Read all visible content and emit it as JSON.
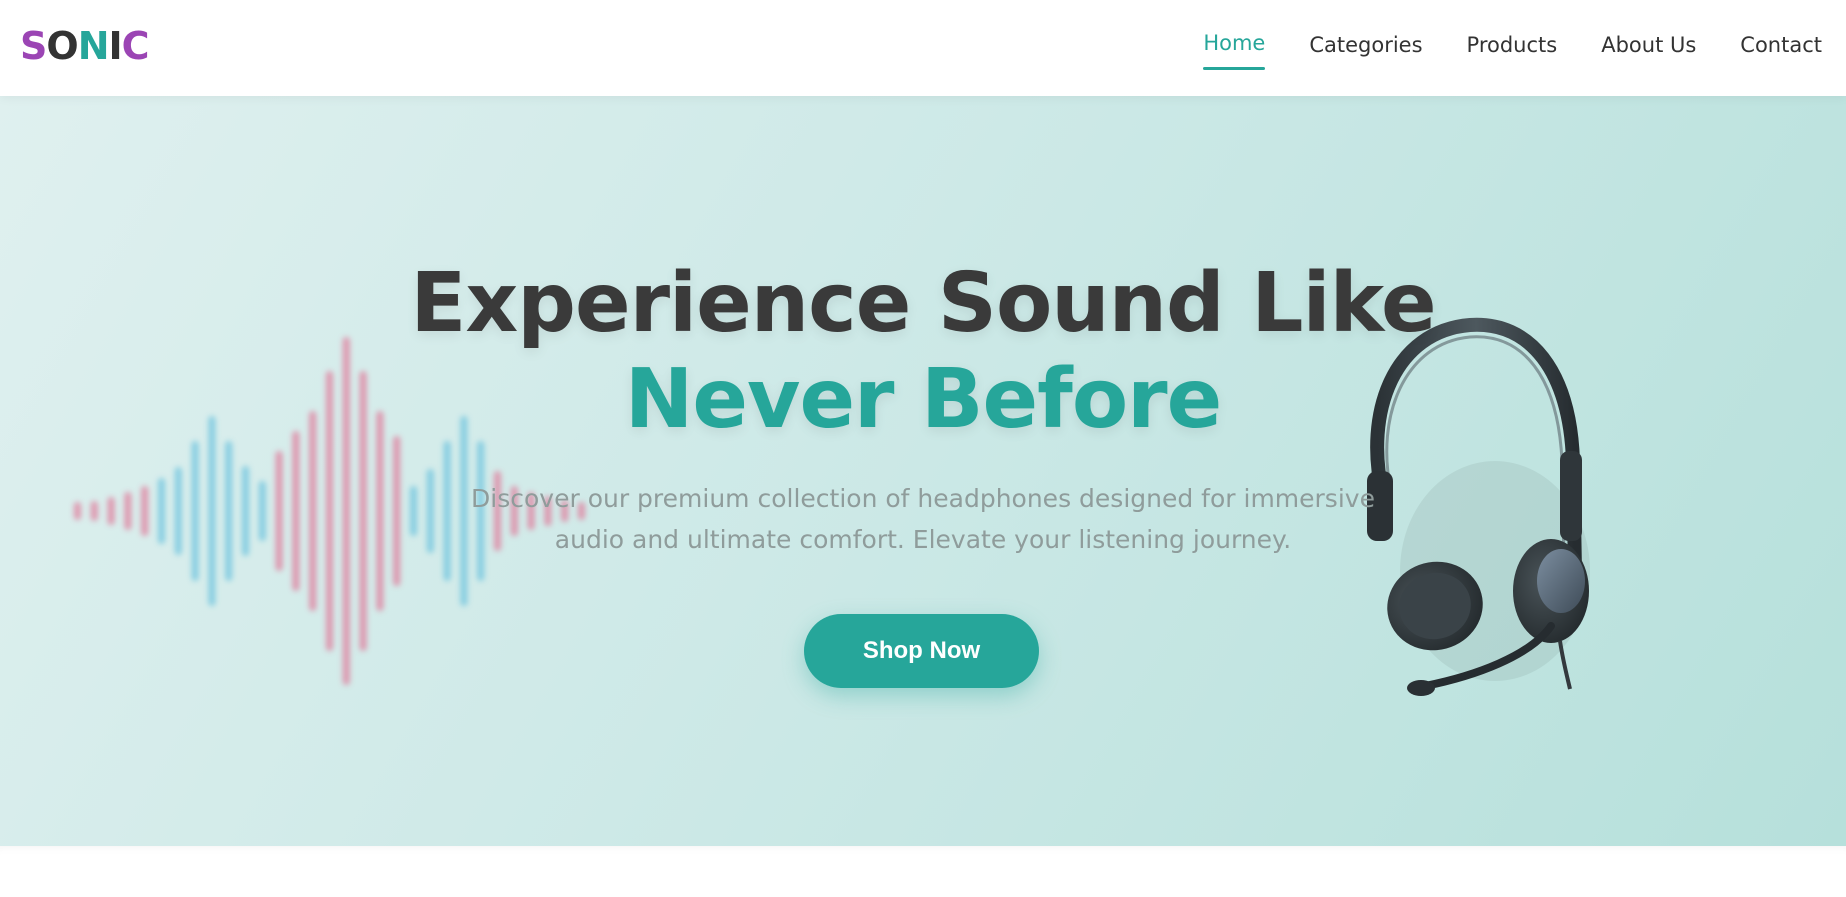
{
  "logo": {
    "letters": [
      "S",
      "O",
      "N",
      "I",
      "C"
    ],
    "colors": [
      "#9b45b4",
      "#333333",
      "#26a69a",
      "#333333",
      "#9b45b4"
    ]
  },
  "nav": {
    "items": [
      {
        "label": "Home",
        "active": true
      },
      {
        "label": "Categories",
        "active": false
      },
      {
        "label": "Products",
        "active": false
      },
      {
        "label": "About Us",
        "active": false
      },
      {
        "label": "Contact",
        "active": false
      }
    ]
  },
  "hero": {
    "title_line1": "Experience Sound Like",
    "title_line2": "Never Before",
    "subtitle": "Discover our premium collection of headphones designed for immersive audio and ultimate comfort. Elevate your listening journey.",
    "cta_label": "Shop Now",
    "images": {
      "left": "soundwave-graphic",
      "right": "headset-with-microphone"
    }
  },
  "colors": {
    "accent": "#26a69a",
    "brand_purple": "#9b45b4",
    "text_dark": "#3a3a3a",
    "wave_pink": "#e07a9a",
    "wave_blue": "#6cc3de"
  }
}
